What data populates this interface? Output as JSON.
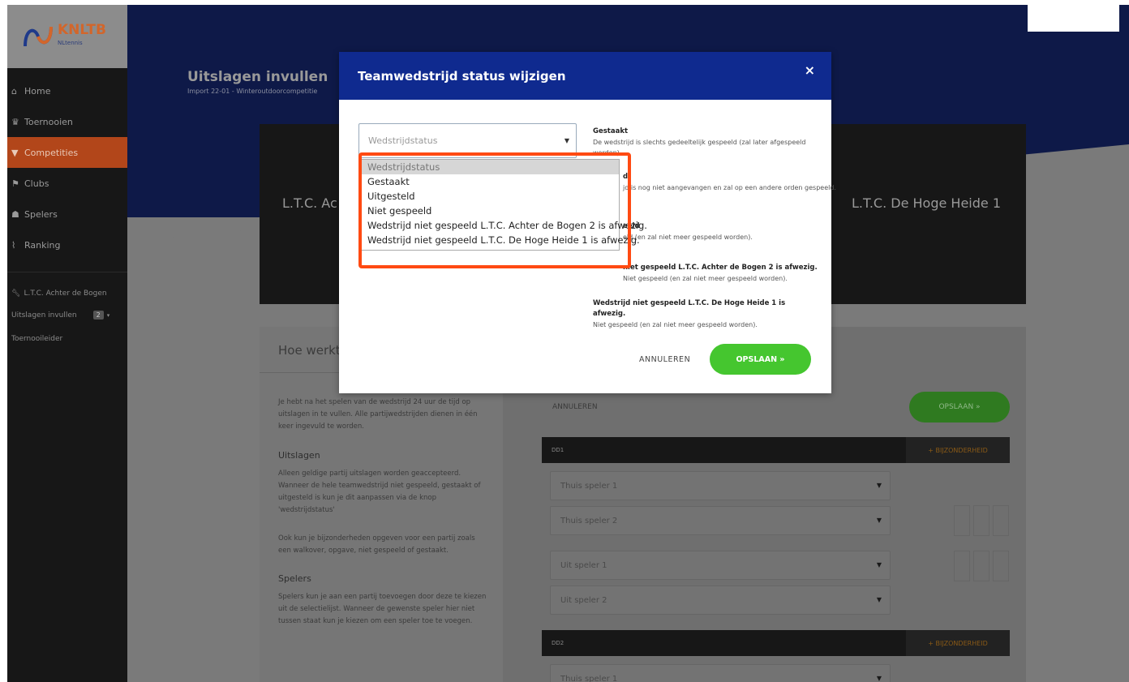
{
  "logo": {
    "name": "KNLTB",
    "sub": "NLtennis"
  },
  "sidebar": {
    "items": [
      {
        "icon": "home-icon",
        "glyph": "⌂",
        "label": "Home"
      },
      {
        "icon": "trophy-icon",
        "glyph": "♛",
        "label": "Toernooien"
      },
      {
        "icon": "cup-icon",
        "glyph": "▼",
        "label": "Competities"
      },
      {
        "icon": "flag-icon",
        "glyph": "⚑",
        "label": "Clubs"
      },
      {
        "icon": "players-icon",
        "glyph": "☗",
        "label": "Spelers"
      },
      {
        "icon": "chart-icon",
        "glyph": "⌇",
        "label": "Ranking"
      }
    ],
    "club": "L.T.C. Achter de Bogen",
    "sub_items": [
      {
        "label": "Uitslagen invullen",
        "badge": "2"
      },
      {
        "label": "Toernooileider"
      }
    ]
  },
  "header": {
    "title": "Uitslagen invullen",
    "subtitle": "Import 22-01 - Winteroutdoorcompetitie"
  },
  "match": {
    "team_home": "L.T.C. Ac",
    "team_away": "L.T.C. De Hoge Heide 1"
  },
  "info": {
    "title": "Hoe werkt",
    "intro": "Je hebt na het spelen van de wedstrijd 24 uur de tijd op uitslagen in te vullen. Alle partijwedstrijden dienen in één keer ingevuld te worden.",
    "h1": "Uitslagen",
    "p1": "Alleen geldige partij uitslagen worden geaccepteerd. Wanneer de hele teamwedstrijd niet gespeeld, gestaakt of uitgesteld is kun je dit aanpassen via de knop 'wedstrijdstatus'",
    "p2": "Ook kun je bijzonderheden opgeven voor een partij zoals een walkover, opgave, niet gespeeld of gestaakt.",
    "h2": "Spelers",
    "p3": "Spelers kun je aan een partij toevoegen door deze te kiezen uit de selectielijst. Wanneer de gewenste speler hier niet tussen staat kun je kiezen om een speler toe te voegen."
  },
  "form": {
    "cancel": "ANNULEREN",
    "save": "OPSLAAN »",
    "match1": "DD1",
    "match2": "DD2",
    "bijzonderheid": "+ BIJZONDERHEID",
    "thuis1": "Thuis speler 1",
    "thuis2": "Thuis speler 2",
    "uit1": "Uit speler 1",
    "uit2": "Uit speler 2"
  },
  "modal": {
    "title": "Teamwedstrijd status wijzigen",
    "close": "×",
    "select_placeholder": "Wedstrijdstatus",
    "options": [
      "Wedstrijdstatus",
      "Gestaakt",
      "Uitgesteld",
      "Niet gespeeld",
      "Wedstrijd niet gespeeld L.T.C. Achter de Bogen 2 is afwezig.",
      "Wedstrijd niet gespeeld L.T.C. De Hoge Heide 1 is afwezig."
    ],
    "descriptions": [
      {
        "title": "Gestaakt",
        "text": "De wedstrijd is slechts gedeeltelijk gespeeld (zal later afgespeeld worden)."
      },
      {
        "title": "d",
        "text": "jd is nog niet aangevangen en zal op een andere orden gespeeld."
      },
      {
        "title": "eeld",
        "text": "eld (en zal niet meer gespeeld worden)."
      },
      {
        "title": "niet gespeeld L.T.C. Achter de Bogen 2 is afwezig.",
        "text": "Niet gespeeld (en zal niet meer gespeeld worden)."
      },
      {
        "title": "Wedstrijd niet gespeeld L.T.C. De Hoge Heide 1 is afwezig.",
        "text": "Niet gespeeld (en zal niet meer gespeeld worden)."
      }
    ],
    "cancel": "ANNULEREN",
    "save": "OPSLAAN »"
  },
  "colors": {
    "brand_navy": "#0f2a8f",
    "accent_orange": "#ff4a12",
    "save_green": "#45c62f"
  }
}
